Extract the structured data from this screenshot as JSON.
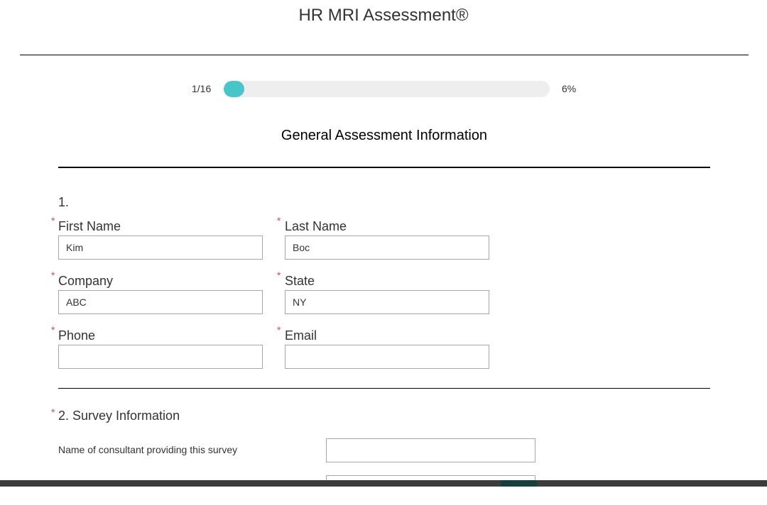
{
  "page": {
    "title": "HR MRI Assessment®"
  },
  "progress": {
    "count": "1/16",
    "percent_label": "6%",
    "fraction": 0.0625
  },
  "section": {
    "title": "General Assessment Information"
  },
  "question1": {
    "number": "1.",
    "required_marker": "*",
    "fields": {
      "first_name": {
        "label": "First Name",
        "value": "Kim"
      },
      "last_name": {
        "label": "Last Name",
        "value": "Boc"
      },
      "company": {
        "label": "Company",
        "value": "ABC"
      },
      "state": {
        "label": "State",
        "value": "NY"
      },
      "phone": {
        "label": "Phone",
        "value": ""
      },
      "email": {
        "label": "Email",
        "value": ""
      }
    }
  },
  "question2": {
    "label": "2. Survey Information",
    "required_marker": "*",
    "consultant_label": "Name of consultant providing this survey",
    "consultant_value": ""
  },
  "colors": {
    "progress_fill": "#47c6c9",
    "progress_track": "#eeeeee",
    "required": "#e0474c"
  }
}
